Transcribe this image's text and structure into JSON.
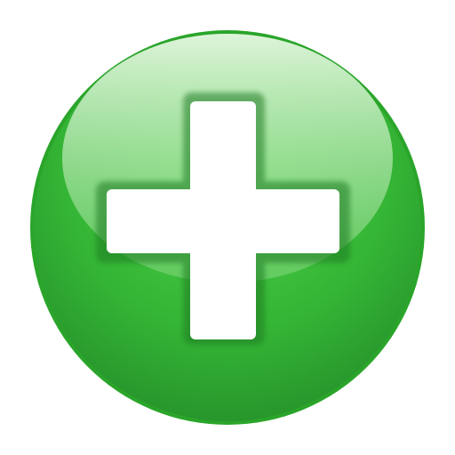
{
  "button": {
    "icon": "plus-icon",
    "colors": {
      "rim": "#2aa52a",
      "body_top": "#4fd04a",
      "body_bottom": "#248f2a",
      "gloss_top": "#e6f7e2",
      "gloss_bottom": "#7fd67a",
      "cross": "#ffffff",
      "cross_outline": "#1f7a22"
    }
  }
}
